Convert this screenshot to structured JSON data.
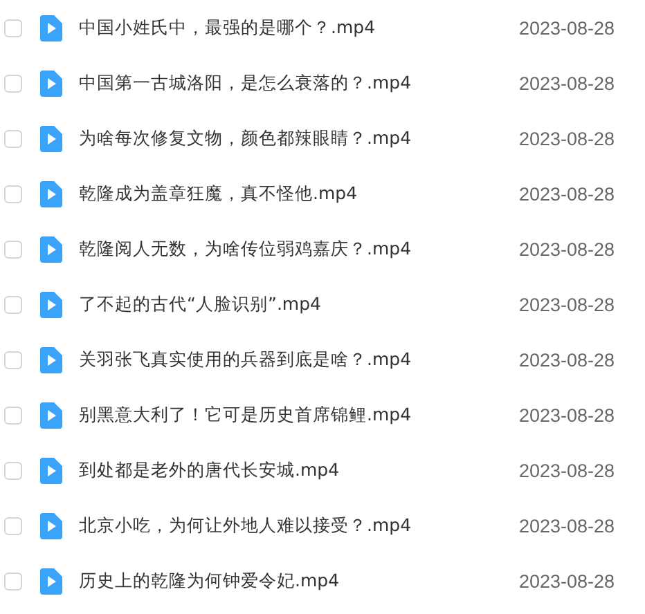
{
  "files": [
    {
      "name": "中国小姓氏中，最强的是哪个？.mp4",
      "date": "2023-08-28",
      "checked": false
    },
    {
      "name": "中国第一古城洛阳，是怎么衰落的？.mp4",
      "date": "2023-08-28",
      "checked": false
    },
    {
      "name": "为啥每次修复文物，颜色都辣眼睛？.mp4",
      "date": "2023-08-28",
      "checked": false
    },
    {
      "name": "乾隆成为盖章狂魔，真不怪他.mp4",
      "date": "2023-08-28",
      "checked": false
    },
    {
      "name": "乾隆阅人无数，为啥传位弱鸡嘉庆？.mp4",
      "date": "2023-08-28",
      "checked": false
    },
    {
      "name": "了不起的古代“人脸识别”.mp4",
      "date": "2023-08-28",
      "checked": false
    },
    {
      "name": "关羽张飞真实使用的兵器到底是啥？.mp4",
      "date": "2023-08-28",
      "checked": false
    },
    {
      "name": "别黑意大利了！它可是历史首席锦鲤.mp4",
      "date": "2023-08-28",
      "checked": false
    },
    {
      "name": "到处都是老外的唐代长安城.mp4",
      "date": "2023-08-28",
      "checked": false
    },
    {
      "name": "北京小吃，为何让外地人难以接受？.mp4",
      "date": "2023-08-28",
      "checked": false
    },
    {
      "name": "历史上的乾隆为何钟爱令妃.mp4",
      "date": "2023-08-28",
      "checked": false
    }
  ]
}
